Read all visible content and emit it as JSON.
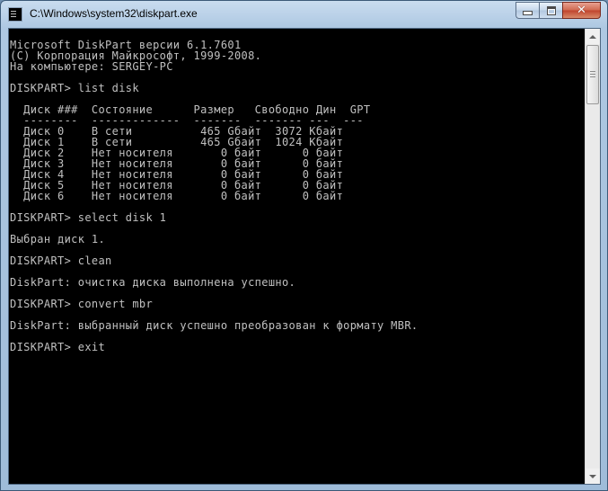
{
  "window": {
    "title": "C:\\Windows\\system32\\diskpart.exe"
  },
  "caption_buttons": {
    "minimize": "minimize",
    "maximize": "maximize",
    "close": "close"
  },
  "console": {
    "lines": [
      "Microsoft DiskPart версии 6.1.7601",
      "(C) Корпорация Майкрософт, 1999-2008.",
      "На компьютере: SERGEY-PC",
      "",
      "DISKPART> list disk",
      "",
      "  Диск ###  Состояние      Размер   Свободно Дин  GPT",
      "  --------  -------------  -------  ------- ---  ---",
      "  Диск 0    В сети          465 Gбайт  3072 Кбайт",
      "  Диск 1    В сети          465 Gбайт  1024 Кбайт",
      "  Диск 2    Нет носителя       0 байт      0 байт",
      "  Диск 3    Нет носителя       0 байт      0 байт",
      "  Диск 4    Нет носителя       0 байт      0 байт",
      "  Диск 5    Нет носителя       0 байт      0 байт",
      "  Диск 6    Нет носителя       0 байт      0 байт",
      "",
      "DISKPART> select disk 1",
      "",
      "Выбран диск 1.",
      "",
      "DISKPART> clean",
      "",
      "DiskPart: очистка диска выполнена успешно.",
      "",
      "DISKPART> convert mbr",
      "",
      "DiskPart: выбранный диск успешно преобразован к формату MBR.",
      "",
      "DISKPART> exit"
    ]
  },
  "colors": {
    "console_background": "#000000",
    "console_text": "#c0c0c0",
    "close_button": "#c0432c"
  }
}
